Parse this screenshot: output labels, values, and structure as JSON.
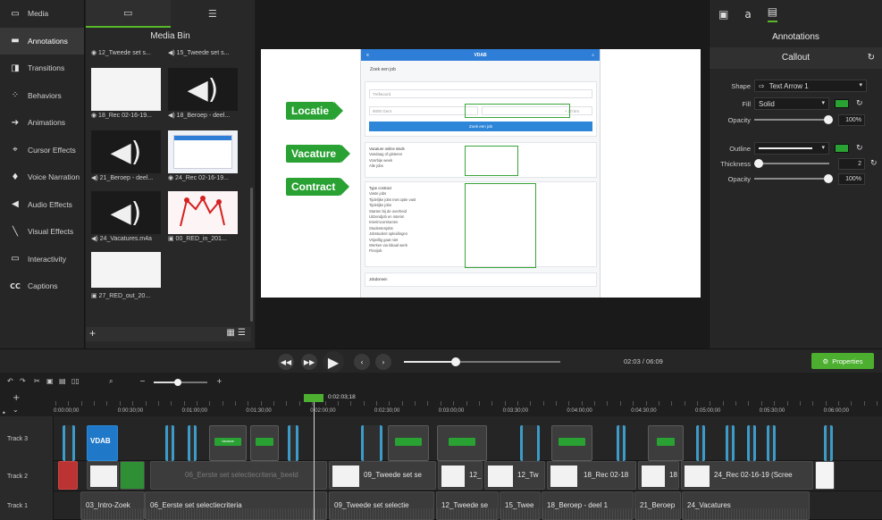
{
  "tools": [
    {
      "label": "Media",
      "icon": "film-icon",
      "active": false
    },
    {
      "label": "Annotations",
      "icon": "annotation-icon",
      "active": true
    },
    {
      "label": "Transitions",
      "icon": "transition-icon",
      "active": false
    },
    {
      "label": "Behaviors",
      "icon": "behavior-icon",
      "active": false
    },
    {
      "label": "Animations",
      "icon": "arrow-icon",
      "active": false
    },
    {
      "label": "Cursor Effects",
      "icon": "cursor-icon",
      "active": false
    },
    {
      "label": "Voice Narration",
      "icon": "microphone-icon",
      "active": false
    },
    {
      "label": "Audio Effects",
      "icon": "speaker-icon",
      "active": false
    },
    {
      "label": "Visual Effects",
      "icon": "wand-icon",
      "active": false
    },
    {
      "label": "Interactivity",
      "icon": "interactivity-icon",
      "active": false
    },
    {
      "label": "Captions",
      "icon": "cc-icon",
      "active": false
    }
  ],
  "bin": {
    "title": "Media Bin",
    "items": [
      {
        "label": "◉ 12_Tweede set s...",
        "kind": "none"
      },
      {
        "label": "◀) 15_Tweede set s...",
        "kind": "none"
      },
      {
        "label": "◉ 18_Rec 02-16-19...",
        "kind": "doc"
      },
      {
        "label": "◀) 18_Beroep - deel...",
        "kind": "audio"
      },
      {
        "label": "◀) 21_Beroep - deel...",
        "kind": "audio"
      },
      {
        "label": "◉ 24_Rec 02-16-19...",
        "kind": "doc"
      },
      {
        "label": "◀) 24_Vacatures.m4a",
        "kind": "audio"
      },
      {
        "label": "▣ 00_RED_in_201...",
        "kind": "red"
      },
      {
        "label": "▣ 27_RED_out_20...",
        "kind": "white"
      }
    ]
  },
  "canvas": {
    "app_name": "VDAB",
    "search_title": "Zoek een job",
    "field_trefwoord": "Trefwoord",
    "field_location": "9000 Gent",
    "field_radius": "+ 20 km",
    "search_button": "Zoek een job",
    "section_vacature": "Vacature online sinds",
    "vacature_options": [
      "Vandaag of gisteren",
      "Voorbije week",
      "Alle jobs"
    ],
    "section_contract": "Type contract",
    "contract_options": [
      "Vaste jobs",
      "Tijdelijke jobs met optie vast",
      "Tijdelijke jobs",
      "Starten bij de overheid",
      "Uitzendjob en interim",
      "Interimcontracten",
      "Studentenjobs",
      "Jobstudent opleidingen",
      "Vrijwillig gaat niet",
      "Werken via lokaal werk",
      "Flexijob"
    ],
    "section_bottom": "Jobdomein",
    "callouts": [
      "Locatie",
      "Vacature",
      "Contract"
    ]
  },
  "props": {
    "tabs": [
      "▣",
      "a",
      "▤"
    ],
    "title": "Annotations",
    "subtitle": "Callout",
    "shape_label": "Shape",
    "shape_value": "Text Arrow 1",
    "fill_label": "Fill",
    "fill_value": "Solid",
    "opacity_label": "Opacity",
    "opacity_value": "100%",
    "outline_label": "Outline",
    "thickness_label": "Thickness",
    "thickness_value": "2",
    "opacity2_label": "Opacity",
    "opacity2_value": "100%",
    "accent": "#29a133"
  },
  "playback": {
    "timecode": "02:03 / 06:09",
    "progress": 0.33,
    "properties_label": "Properties"
  },
  "timeline": {
    "playhead_time": "0:02:03;18",
    "zoom": 0.45,
    "ticks": [
      "0:00:00;00",
      "0:00:30;00",
      "0:01:00;00",
      "0:01:30;00",
      "0:02:00;00",
      "0:02:30;00",
      "0:03:00;00",
      "0:03:30;00",
      "0:04:00;00",
      "0:04:30;00",
      "0:05:00;00",
      "0:05:30;00",
      "0:06:00;00"
    ],
    "tracks": [
      {
        "name": "Track 3"
      },
      {
        "name": "Track 2"
      },
      {
        "name": "Track 1"
      }
    ],
    "callout_chip": "Vacature",
    "track2_clips": [
      "06_Eerste set selectiecriteria_beeld",
      "09_Tweede set se",
      "12_",
      "12_Tw",
      "18_Rec 02-18",
      "18",
      "24_Rec 02-16-19 (Scree"
    ],
    "track1_clips": [
      "03_Intro-Zoek",
      "06_Eerste set selectiecriteria",
      "09_Tweede set selectie",
      "12_Tweede se",
      "15_Twee",
      "18_Beroep - deel 1",
      "21_Beroep",
      "24_Vacatures"
    ]
  }
}
